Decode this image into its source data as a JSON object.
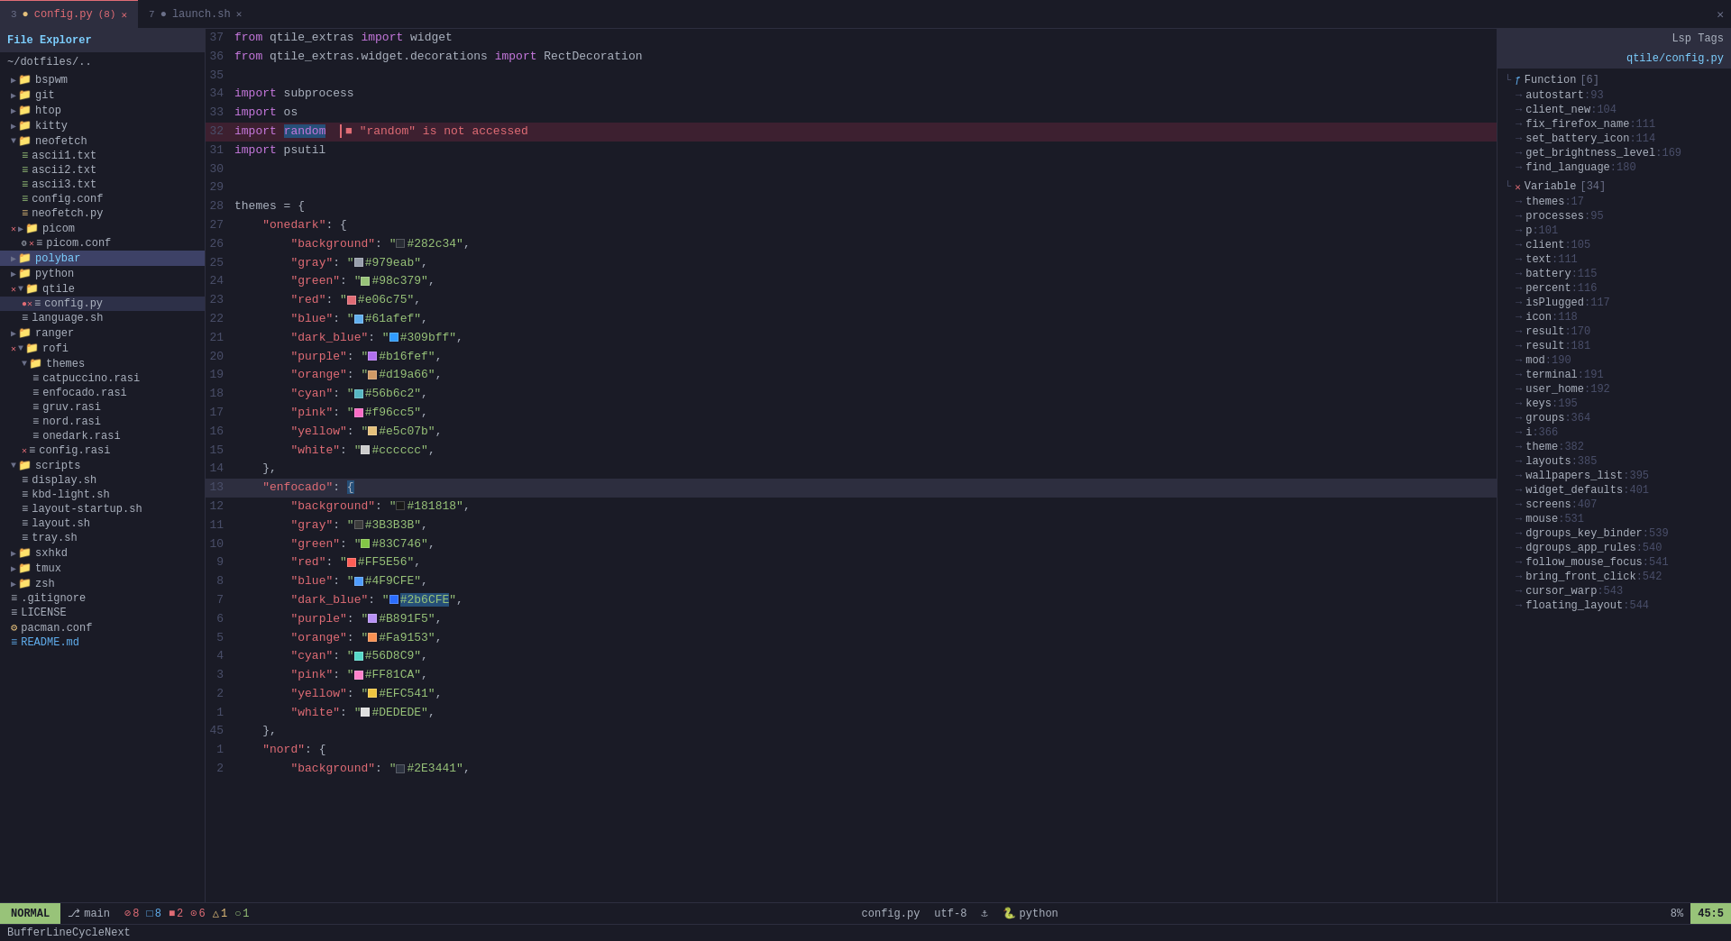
{
  "tabbar": {
    "tabs": [
      {
        "number": "3",
        "icon": "dot-yellow",
        "name": "config.py",
        "badge": "(8)",
        "active": true,
        "closable": true
      },
      {
        "number": "7",
        "icon": "dot-gray",
        "name": "launch.sh",
        "active": false,
        "closable": true
      }
    ],
    "close_icon": "✕"
  },
  "file_explorer": {
    "title": "File Explorer",
    "root": "~/dotfiles/..",
    "items": [
      {
        "label": "bspwm",
        "type": "folder",
        "indent": 1,
        "open": false
      },
      {
        "label": "git",
        "type": "folder",
        "indent": 1,
        "open": false
      },
      {
        "label": "htop",
        "type": "folder",
        "indent": 1,
        "open": false
      },
      {
        "label": "kitty",
        "type": "folder",
        "indent": 1,
        "open": false
      },
      {
        "label": "neofetch",
        "type": "folder",
        "indent": 1,
        "open": true
      },
      {
        "label": "ascii1.txt",
        "type": "file-green",
        "indent": 2
      },
      {
        "label": "ascii2.txt",
        "type": "file-green",
        "indent": 2
      },
      {
        "label": "ascii3.txt",
        "type": "file-green",
        "indent": 2
      },
      {
        "label": "config.conf",
        "type": "file-green",
        "indent": 2
      },
      {
        "label": "neofetch.py",
        "type": "file-yellow",
        "indent": 2
      },
      {
        "label": "picom",
        "type": "folder",
        "indent": 1,
        "open": false,
        "prefix": "x"
      },
      {
        "label": "picom.conf",
        "type": "file",
        "indent": 2,
        "prefix": "gear x"
      },
      {
        "label": "polybar",
        "type": "folder",
        "indent": 1,
        "open": false,
        "selected": true
      },
      {
        "label": "python",
        "type": "folder",
        "indent": 1,
        "open": false
      },
      {
        "label": "qtile",
        "type": "folder",
        "indent": 1,
        "open": true,
        "prefix": "x"
      },
      {
        "label": "config.py",
        "type": "file",
        "indent": 2,
        "prefix": "error x",
        "active": true
      },
      {
        "label": "language.sh",
        "type": "file",
        "indent": 2
      },
      {
        "label": "ranger",
        "type": "folder",
        "indent": 1,
        "open": false
      },
      {
        "label": "rofi",
        "type": "folder",
        "indent": 1,
        "open": true,
        "prefix": "x"
      },
      {
        "label": "themes",
        "type": "folder",
        "indent": 2,
        "open": true
      },
      {
        "label": "catpuccino.rasi",
        "type": "file",
        "indent": 3
      },
      {
        "label": "enfocado.rasi",
        "type": "file",
        "indent": 3
      },
      {
        "label": "gruv.rasi",
        "type": "file",
        "indent": 3
      },
      {
        "label": "nord.rasi",
        "type": "file",
        "indent": 3
      },
      {
        "label": "onedark.rasi",
        "type": "file",
        "indent": 3
      },
      {
        "label": "config.rasi",
        "type": "file",
        "indent": 2,
        "prefix": "x"
      },
      {
        "label": "scripts",
        "type": "folder",
        "indent": 1,
        "open": true
      },
      {
        "label": "display.sh",
        "type": "file",
        "indent": 2
      },
      {
        "label": "kbd-light.sh",
        "type": "file",
        "indent": 2
      },
      {
        "label": "layout-startup.sh",
        "type": "file",
        "indent": 2
      },
      {
        "label": "layout.sh",
        "type": "file",
        "indent": 2
      },
      {
        "label": "tray.sh",
        "type": "file",
        "indent": 2
      },
      {
        "label": "sxhkd",
        "type": "folder",
        "indent": 1,
        "open": false
      },
      {
        "label": "tmux",
        "type": "folder",
        "indent": 1,
        "open": false
      },
      {
        "label": "zsh",
        "type": "folder",
        "indent": 1,
        "open": false
      },
      {
        "label": ".gitignore",
        "type": "file",
        "indent": 1
      },
      {
        "label": "LICENSE",
        "type": "file",
        "indent": 1
      },
      {
        "label": "pacman.conf",
        "type": "file-yellow",
        "indent": 1
      },
      {
        "label": "README.md",
        "type": "file-blue",
        "indent": 1
      }
    ]
  },
  "code": {
    "lines": [
      {
        "num": "37",
        "content": "from qtile_extras import widget",
        "tokens": [
          {
            "t": "kw",
            "v": "from"
          },
          {
            "t": "plain",
            "v": " qtile_extras "
          },
          {
            "t": "kw",
            "v": "import"
          },
          {
            "t": "plain",
            "v": " widget"
          }
        ]
      },
      {
        "num": "36",
        "content": "from qtile_extras.widget.decorations import RectDecoration",
        "tokens": [
          {
            "t": "kw",
            "v": "from"
          },
          {
            "t": "plain",
            "v": " qtile_extras.widget.decorations "
          },
          {
            "t": "kw",
            "v": "import"
          },
          {
            "t": "plain",
            "v": " RectDecoration"
          }
        ]
      },
      {
        "num": "35",
        "content": ""
      },
      {
        "num": "34",
        "content": "import subprocess",
        "tokens": [
          {
            "t": "kw",
            "v": "import"
          },
          {
            "t": "plain",
            "v": " subprocess"
          }
        ]
      },
      {
        "num": "33",
        "content": "import os",
        "tokens": [
          {
            "t": "kw",
            "v": "import"
          },
          {
            "t": "plain",
            "v": " os"
          }
        ]
      },
      {
        "num": "32",
        "content": "import random",
        "tokens": [
          {
            "t": "kw",
            "v": "import"
          },
          {
            "t": "plain",
            "v": " "
          },
          {
            "t": "nm",
            "v": "random"
          }
        ],
        "error": true,
        "error_msg": "\"random\" is not accessed",
        "highlight": true
      },
      {
        "num": "31",
        "content": "import psutil",
        "tokens": [
          {
            "t": "kw",
            "v": "import"
          },
          {
            "t": "plain",
            "v": " psutil"
          }
        ]
      },
      {
        "num": "30",
        "content": ""
      },
      {
        "num": "29",
        "content": ""
      },
      {
        "num": "28",
        "content": "themes = {",
        "tokens": [
          {
            "t": "plain",
            "v": "themes = {"
          }
        ]
      },
      {
        "num": "27",
        "content": "    \"onedark\": {",
        "tokens": [
          {
            "t": "plain",
            "v": "    "
          },
          {
            "t": "key",
            "v": "\"onedark\""
          },
          {
            "t": "plain",
            "v": ": {"
          }
        ]
      },
      {
        "num": "26",
        "content": "        \"background\": \"#282c34\",",
        "color": "#282c34"
      },
      {
        "num": "25",
        "content": "        \"gray\": \"#979eab\",",
        "color": "#979eab"
      },
      {
        "num": "24",
        "content": "        \"green\": \"#98c379\",",
        "color": "#98c379"
      },
      {
        "num": "23",
        "content": "        \"red\": \"#e06c75\",",
        "color": "#e06c75"
      },
      {
        "num": "22",
        "content": "        \"blue\": \"#61afef\",",
        "color": "#61afef"
      },
      {
        "num": "21",
        "content": "        \"dark_blue\": \"#309bff\",",
        "color": "#309bff"
      },
      {
        "num": "20",
        "content": "        \"purple\": \"#b16fef\",",
        "color": "#b16fef"
      },
      {
        "num": "19",
        "content": "        \"orange\": \"#d19a66\",",
        "color": "#d19a66"
      },
      {
        "num": "18",
        "content": "        \"cyan\": \"#56b6c2\",",
        "color": "#56b6c2"
      },
      {
        "num": "17",
        "content": "        \"pink\": \"#f96cc5\",",
        "color": "#f96cc5"
      },
      {
        "num": "16",
        "content": "        \"yellow\": \"#e5c07b\",",
        "color": "#e5c07b"
      },
      {
        "num": "15",
        "content": "        \"white\": \"#cccccc\",",
        "color": "#cccccc"
      },
      {
        "num": "14",
        "content": "    },"
      },
      {
        "num": "13",
        "content": "    \"enfocado\": {",
        "highlight_cursor": true
      },
      {
        "num": "12",
        "content": "        \"background\": \"#181818\",",
        "color": "#181818"
      },
      {
        "num": "11",
        "content": "        \"gray\": \"#3B3B3B\",",
        "color": "#3B3B3B"
      },
      {
        "num": "10",
        "content": "        \"green\": \"#83C746\",",
        "color": "#83C746"
      },
      {
        "num": "9",
        "content": "        \"red\": \"#FF5E56\",",
        "color": "#FF5E56"
      },
      {
        "num": "8",
        "content": "        \"blue\": \"#4F9CFE\",",
        "color": "#4F9CFE"
      },
      {
        "num": "7",
        "content": "        \"dark_blue\": \"#2b6CFE\",",
        "color": "#2b6CFE",
        "highlight_val": true
      },
      {
        "num": "6",
        "content": "        \"purple\": \"#B891F5\",",
        "color": "#B891F5"
      },
      {
        "num": "5",
        "content": "        \"orange\": \"#Fa9153\",",
        "color": "#Fa9153"
      },
      {
        "num": "4",
        "content": "        \"cyan\": \"#56D8C9\",",
        "color": "#56D8C9"
      },
      {
        "num": "3",
        "content": "        \"pink\": \"#FF81CA\",",
        "color": "#FF81CA"
      },
      {
        "num": "2",
        "content": "        \"yellow\": \"#EFC541\",",
        "color": "#EFC541"
      },
      {
        "num": "1",
        "content": "        \"white\": \"#DEDEDE\",",
        "color": "#DEDEDE"
      },
      {
        "num": "45",
        "content": "    },"
      },
      {
        "num": "1",
        "content": "    \"nord\": {"
      },
      {
        "num": "2",
        "content": "        \"background\": \"#2E3441\",",
        "color": "#2E3441"
      }
    ]
  },
  "lsp": {
    "header": "Lsp Tags",
    "file": "qtile/config.py",
    "sections": [
      {
        "type": "Function",
        "count": "[6]",
        "items": [
          {
            "name": "autostart",
            "line": "93"
          },
          {
            "name": "client_new",
            "line": "104"
          },
          {
            "name": "fix_firefox_name",
            "line": "111"
          },
          {
            "name": "set_battery_icon",
            "line": "114"
          },
          {
            "name": "get_brightness_level",
            "line": "169"
          },
          {
            "name": "find_language",
            "line": "180"
          }
        ]
      },
      {
        "type": "Variable",
        "count": "[34]",
        "items": [
          {
            "name": "themes",
            "line": "17"
          },
          {
            "name": "processes",
            "line": "95"
          },
          {
            "name": "p",
            "line": "101"
          },
          {
            "name": "client",
            "line": "105"
          },
          {
            "name": "text",
            "line": "111"
          },
          {
            "name": "battery",
            "line": "115"
          },
          {
            "name": "percent",
            "line": "116"
          },
          {
            "name": "isPlugged",
            "line": "117"
          },
          {
            "name": "icon",
            "line": "118"
          },
          {
            "name": "result",
            "line": "170"
          },
          {
            "name": "result",
            "line": "181"
          },
          {
            "name": "mod",
            "line": "190"
          },
          {
            "name": "terminal",
            "line": "191"
          },
          {
            "name": "user_home",
            "line": "192"
          },
          {
            "name": "keys",
            "line": "195"
          },
          {
            "name": "groups",
            "line": "364"
          },
          {
            "name": "i",
            "line": "366"
          },
          {
            "name": "theme",
            "line": "382"
          },
          {
            "name": "layouts",
            "line": "385"
          },
          {
            "name": "wallpapers_list",
            "line": "395"
          },
          {
            "name": "widget_defaults",
            "line": "401"
          },
          {
            "name": "screens",
            "line": "407"
          },
          {
            "name": "mouse",
            "line": "531"
          },
          {
            "name": "dgroups_key_binder",
            "line": "539"
          },
          {
            "name": "dgroups_app_rules",
            "line": "540"
          },
          {
            "name": "follow_mouse_focus",
            "line": "541"
          },
          {
            "name": "bring_front_click",
            "line": "542"
          },
          {
            "name": "cursor_warp",
            "line": "543"
          },
          {
            "name": "floating_layout",
            "line": "544"
          }
        ]
      }
    ]
  },
  "statusbar": {
    "mode": "NORMAL",
    "branch": "main",
    "diag_error": "8",
    "diag_warn": "2",
    "diag_err2": "6",
    "diag_warn2": "1",
    "diag_info": "1",
    "filename": "config.py",
    "encoding": "utf-8",
    "lang": "python",
    "percent": "8%",
    "position": "45:5"
  },
  "bottom_cmd": "BufferLineCycleNext"
}
